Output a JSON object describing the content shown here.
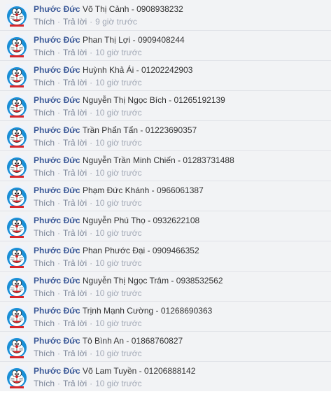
{
  "comments": [
    {
      "author": "Phước Đức",
      "text": "Võ Thị Cảnh - 0908938232",
      "like": "Thích",
      "reply": "Trả lời",
      "time": "9 giờ trước"
    },
    {
      "author": "Phước Đức",
      "text": "Phan Thị Lợi - 0909408244",
      "like": "Thích",
      "reply": "Trả lời",
      "time": "10 giờ trước"
    },
    {
      "author": "Phước Đức",
      "text": "Huỳnh Khả Ái - 01202242903",
      "like": "Thích",
      "reply": "Trả lời",
      "time": "10 giờ trước"
    },
    {
      "author": "Phước Đức",
      "text": "Nguyễn Thị Ngọc Bích - 01265192139",
      "like": "Thích",
      "reply": "Trả lời",
      "time": "10 giờ trước"
    },
    {
      "author": "Phước Đức",
      "text": "Trần Phẩn Tẩn - 01223690357",
      "like": "Thích",
      "reply": "Trả lời",
      "time": "10 giờ trước"
    },
    {
      "author": "Phước Đức",
      "text": "Nguyễn Trần Minh Chiến - 01283731488",
      "like": "Thích",
      "reply": "Trả lời",
      "time": "10 giờ trước"
    },
    {
      "author": "Phước Đức",
      "text": "Phạm Đức Khánh - 0966061387",
      "like": "Thích",
      "reply": "Trả lời",
      "time": "10 giờ trước"
    },
    {
      "author": "Phước Đức",
      "text": "Nguyễn Phú Thọ - 0932622108",
      "like": "Thích",
      "reply": "Trả lời",
      "time": "10 giờ trước"
    },
    {
      "author": "Phước Đức",
      "text": "Phan Phước Đại - 0909466352",
      "like": "Thích",
      "reply": "Trả lời",
      "time": "10 giờ trước"
    },
    {
      "author": "Phước Đức",
      "text": "Nguyễn Thị Ngọc Trâm - 0938532562",
      "like": "Thích",
      "reply": "Trả lời",
      "time": "10 giờ trước"
    },
    {
      "author": "Phước Đức",
      "text": "Trịnh Mạnh Cường - 01268690363",
      "like": "Thích",
      "reply": "Trả lời",
      "time": "10 giờ trước"
    },
    {
      "author": "Phước Đức",
      "text": "Tô Bình An - 01868760827",
      "like": "Thích",
      "reply": "Trả lời",
      "time": "10 giờ trước"
    },
    {
      "author": "Phước Đức",
      "text": "Võ Lam Tuyền - 01206888142",
      "like": "Thích",
      "reply": "Trả lời",
      "time": "10 giờ trước"
    }
  ],
  "separator": "·",
  "colors": {
    "author": "#3b5998",
    "row_background": "#f2f3f5",
    "meta": "#8e9aae",
    "avatar_blue": "#1a8fd6"
  },
  "icons": {
    "avatar": "doraemon-avatar-icon"
  }
}
